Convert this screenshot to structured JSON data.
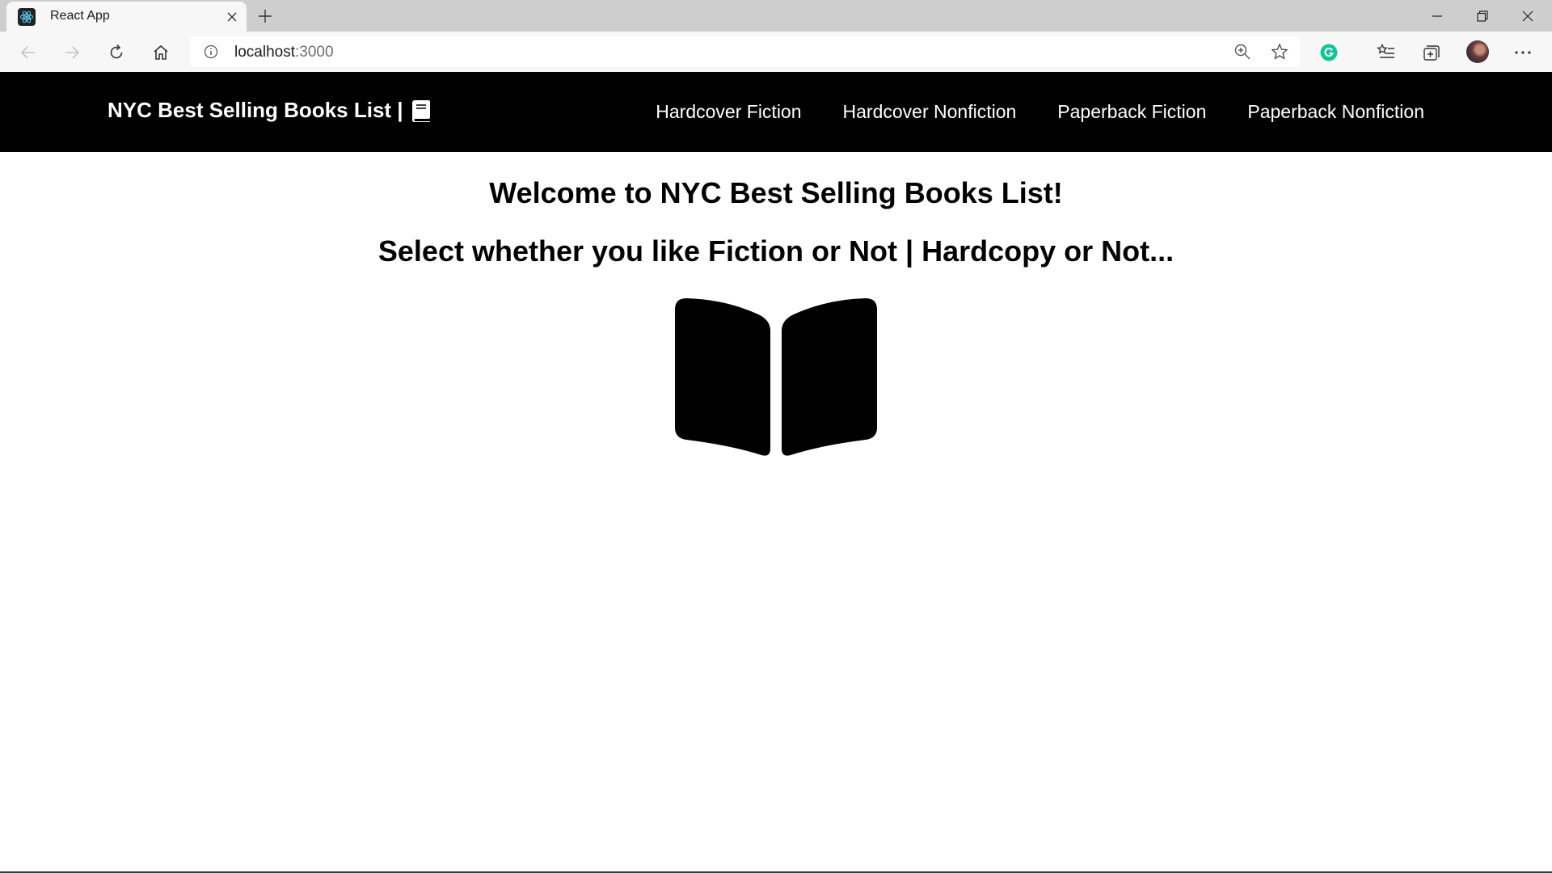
{
  "browser": {
    "tab": {
      "title": "React App",
      "favicon": "react-icon"
    },
    "address": {
      "host": "localhost",
      "port": ":3000"
    },
    "colors": {
      "tabstrip": "#cecece",
      "toolbar": "#f7f7f7",
      "grammarly": "#15c39a"
    }
  },
  "navbar": {
    "brand": "NYC Best Selling Books List |",
    "brand_icon": "book-icon",
    "links": [
      {
        "label": "Hardcover Fiction"
      },
      {
        "label": "Hardcover Nonfiction"
      },
      {
        "label": "Paperback Fiction"
      },
      {
        "label": "Paperback Nonfiction"
      }
    ],
    "background": "#000000"
  },
  "main": {
    "welcome": "Welcome to NYC Best Selling Books List!",
    "subtitle": "Select whether you like Fiction or Not | Hardcopy or Not...",
    "hero_icon": "open-book-icon"
  }
}
